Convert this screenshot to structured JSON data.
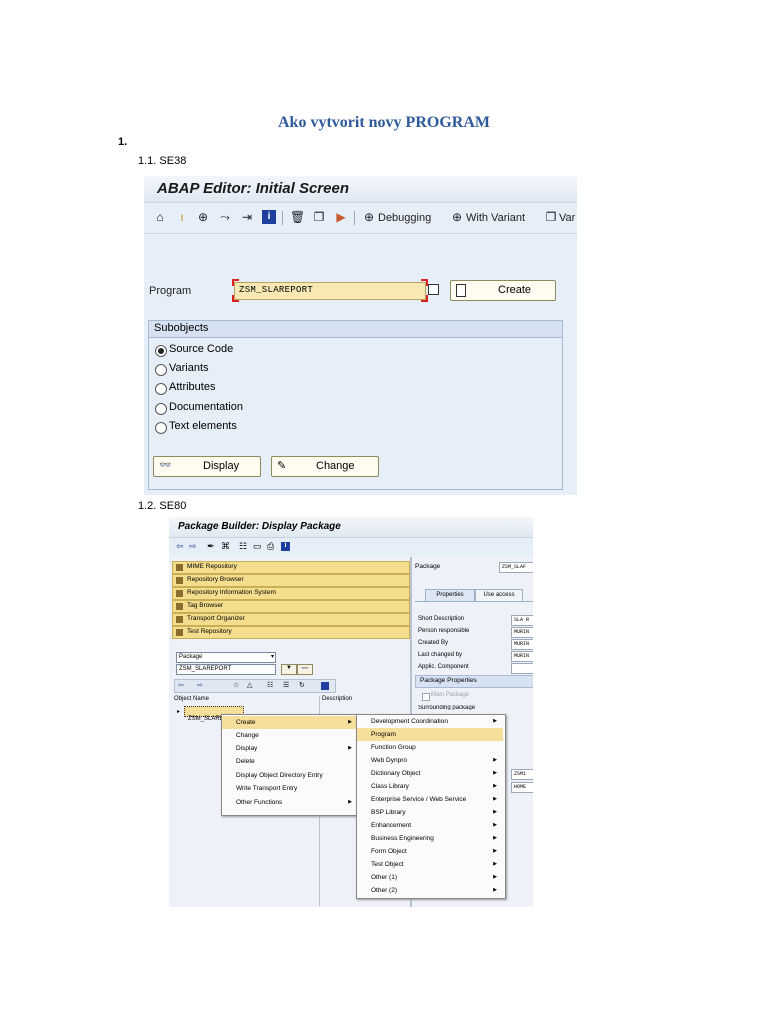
{
  "doc": {
    "title": "Ako vytvorit novy PROGRAM",
    "section_number": "1.",
    "step1": "1.1.  SE38",
    "step2": "1.2.  SE80"
  },
  "editor": {
    "window_title": "ABAP Editor: Initial Screen",
    "toolbar": {
      "debugging": "Debugging",
      "with_variant": "With Variant",
      "variants_cut": "Var"
    },
    "program_label": "Program",
    "program_value": "ZSM_SLAREPORT",
    "create_button": "Create",
    "subobjects_title": "Subobjects",
    "subobjects": [
      {
        "label": "Source Code",
        "selected": true
      },
      {
        "label": "Variants",
        "selected": false
      },
      {
        "label": "Attributes",
        "selected": false
      },
      {
        "label": "Documentation",
        "selected": false
      },
      {
        "label": "Text elements",
        "selected": false
      }
    ],
    "display_button": "Display",
    "change_button": "Change"
  },
  "package_builder": {
    "window_title": "Package Builder: Display Package",
    "nav": [
      "MIME Repository",
      "Repository Browser",
      "Repository Information System",
      "Tag Browser",
      "Transport Organizer",
      "Test Repository"
    ],
    "object_type": "Package",
    "object_value": "ZSM_SLAREPORT",
    "tree_col_name": "Object Name",
    "tree_col_desc": "Description",
    "tree_node": "ZSM_SLAREPORT",
    "right": {
      "package_label": "Package",
      "package_value": "ZSM_SLAF",
      "tab_properties": "Properties",
      "tab_use_access": "Use access",
      "fields": [
        {
          "label": "Short Description",
          "value": "SLA R"
        },
        {
          "label": "Person responsible",
          "value": "MURIN"
        },
        {
          "label": "Created By",
          "value": "MURIN"
        },
        {
          "label": "Last changed by",
          "value": "MURIN"
        },
        {
          "label": "Applic. Component",
          "value": ""
        }
      ],
      "package_properties": "Package Properties",
      "main_package": "Main Package",
      "surrounding_package": "Surrounding package",
      "extra_values": [
        "ZSM1",
        "HOME"
      ]
    },
    "context_menu": [
      {
        "label": "Create",
        "submenu": true,
        "highlight": true
      },
      {
        "label": "Change",
        "submenu": false
      },
      {
        "label": "Display",
        "submenu": true
      },
      {
        "label": "Delete",
        "submenu": false
      },
      {
        "label": "Display Object Directory Entry",
        "submenu": false
      },
      {
        "label": "Write Transport Entry",
        "submenu": false
      },
      {
        "label": "Other Functions",
        "submenu": true
      }
    ],
    "create_submenu": [
      {
        "label": "Development Coordination",
        "submenu": true
      },
      {
        "label": "Program",
        "submenu": false,
        "highlight": true
      },
      {
        "label": "Function Group",
        "submenu": false
      },
      {
        "label": "Web Dynpro",
        "submenu": true
      },
      {
        "label": "Dictionary Object",
        "submenu": true
      },
      {
        "label": "Class Library",
        "submenu": true
      },
      {
        "label": "Enterprise Service / Web Service",
        "submenu": true
      },
      {
        "label": "BSP Library",
        "submenu": true
      },
      {
        "label": "Enhancement",
        "submenu": true
      },
      {
        "label": "Business Engineering",
        "submenu": true
      },
      {
        "label": "Form Object",
        "submenu": true
      },
      {
        "label": "Test Object",
        "submenu": true
      },
      {
        "label": "Other (1)",
        "submenu": true
      },
      {
        "label": "Other (2)",
        "submenu": true
      }
    ]
  },
  "colors": {
    "title_blue": "#2e5a9a",
    "sap_bg": "#e6eef8",
    "highlight": "#f6df9a"
  }
}
